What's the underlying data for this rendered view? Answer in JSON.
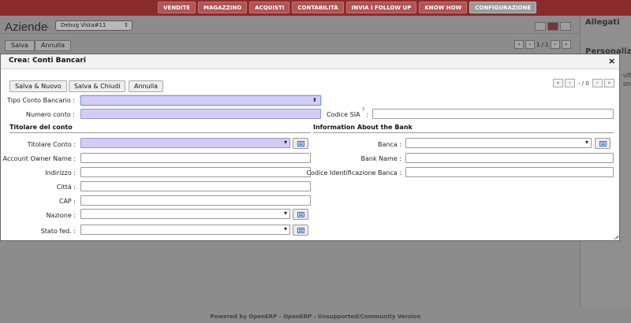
{
  "topnav": [
    "VENDITE",
    "MAGAZZINO",
    "ACQUISTI",
    "CONTABILITÀ",
    "INVIA I FOLLOW UP",
    "KNOW HOW",
    "CONFIGURAZIONE"
  ],
  "background": {
    "title": "Aziende",
    "crumb": "›",
    "debug_select": "Debug Vista#11",
    "save_label": "Salva",
    "cancel_label": "Annulla",
    "pager": "1 / 1"
  },
  "right_panel": {
    "attachments": "Allegati",
    "personalize": "Personalizza",
    "sub1": "ult",
    "sub2": "on"
  },
  "dialog": {
    "title": "Crea: Conti Bancari",
    "close": "×",
    "buttons": {
      "save_new": "Salva & Nuovo",
      "save_close": "Salva & Chiudi",
      "cancel": "Annulla"
    },
    "pager": "- / 0",
    "fields": {
      "tipo_conto": "Tipo Conto Bancario :",
      "numero_conto": "Numero conto :",
      "codice_sia": "Codice SIA",
      "codice_sia_colon": ":",
      "help_mark": "?"
    },
    "section_left": {
      "title": "Titolare del conto",
      "titolare": "Titolare Conto :",
      "owner_name": "Account Owner Name :",
      "indirizzo": "Indirizzo :",
      "citta": "Città :",
      "cap": "CAP :",
      "nazione": "Nazione :",
      "stato": "Stato fed. :"
    },
    "section_right": {
      "title": "Information About the Bank",
      "banca": "Banca :",
      "bank_name": "Bank Name :",
      "codice_banca": "Codice Identificazione Banca :"
    }
  },
  "footer": "Powered by OpenERP - OpenERP - Unsupported/Community Version",
  "colors": {
    "topbar": "#8a2b2b",
    "required_field": "#d2cdf6",
    "focus_border": "#7d9bd8"
  }
}
